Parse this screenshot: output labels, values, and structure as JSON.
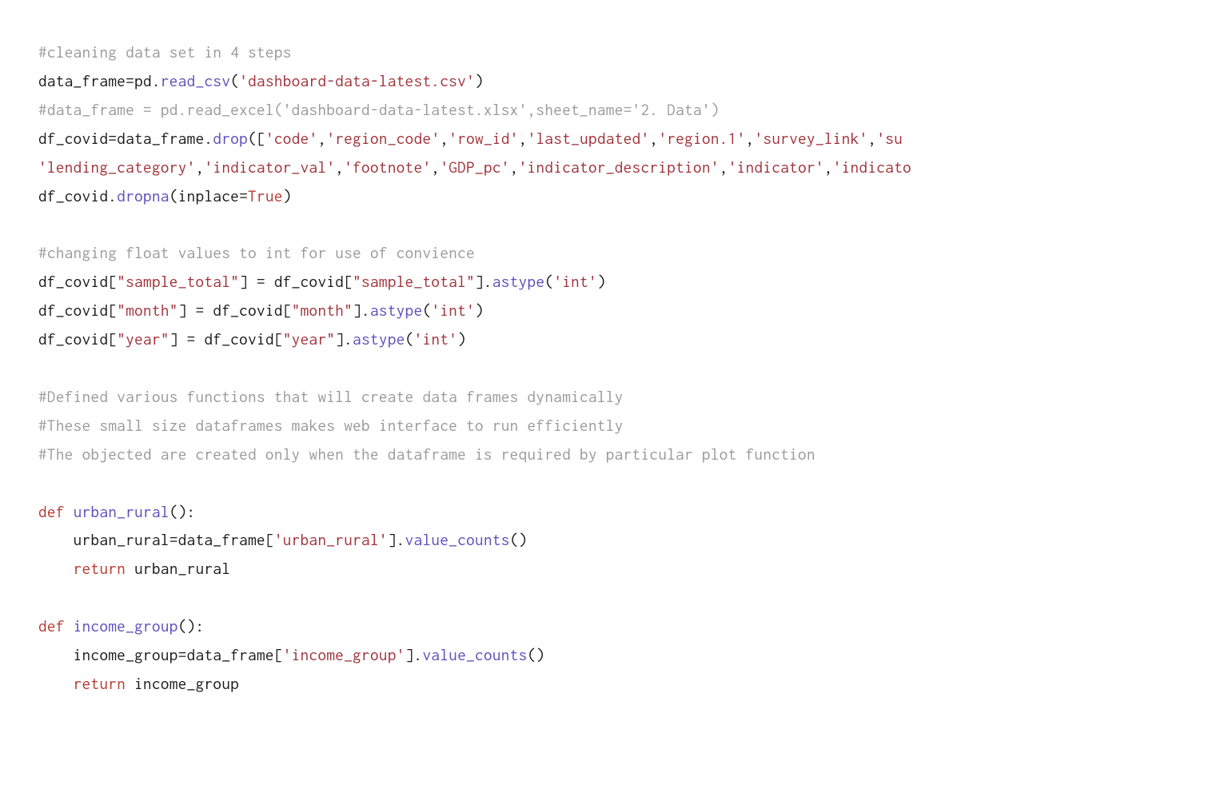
{
  "lines": [
    {
      "tokens": [
        {
          "t": "#cleaning data set in 4 steps",
          "c": "comment"
        }
      ]
    },
    {
      "tokens": [
        {
          "t": "data_frame",
          "c": "plain"
        },
        {
          "t": "=",
          "c": "plain"
        },
        {
          "t": "pd",
          "c": "plain"
        },
        {
          "t": ".",
          "c": "plain"
        },
        {
          "t": "read_csv",
          "c": "func"
        },
        {
          "t": "(",
          "c": "plain"
        },
        {
          "t": "'dashboard-data-latest.csv'",
          "c": "string"
        },
        {
          "t": ")",
          "c": "plain"
        }
      ]
    },
    {
      "tokens": [
        {
          "t": "#data_frame = pd.read_excel('dashboard-data-latest.xlsx',sheet_name='2. Data')",
          "c": "comment"
        }
      ]
    },
    {
      "tokens": [
        {
          "t": "df_covid",
          "c": "plain"
        },
        {
          "t": "=",
          "c": "plain"
        },
        {
          "t": "data_frame",
          "c": "plain"
        },
        {
          "t": ".",
          "c": "plain"
        },
        {
          "t": "drop",
          "c": "func"
        },
        {
          "t": "([",
          "c": "plain"
        },
        {
          "t": "'code'",
          "c": "string"
        },
        {
          "t": ",",
          "c": "plain"
        },
        {
          "t": "'region_code'",
          "c": "string"
        },
        {
          "t": ",",
          "c": "plain"
        },
        {
          "t": "'row_id'",
          "c": "string"
        },
        {
          "t": ",",
          "c": "plain"
        },
        {
          "t": "'last_updated'",
          "c": "string"
        },
        {
          "t": ",",
          "c": "plain"
        },
        {
          "t": "'region.1'",
          "c": "string"
        },
        {
          "t": ",",
          "c": "plain"
        },
        {
          "t": "'survey_link'",
          "c": "string"
        },
        {
          "t": ",",
          "c": "plain"
        },
        {
          "t": "'su",
          "c": "string"
        }
      ]
    },
    {
      "tokens": [
        {
          "t": "'lending_category'",
          "c": "string"
        },
        {
          "t": ",",
          "c": "plain"
        },
        {
          "t": "'indicator_val'",
          "c": "string"
        },
        {
          "t": ",",
          "c": "plain"
        },
        {
          "t": "'footnote'",
          "c": "string"
        },
        {
          "t": ",",
          "c": "plain"
        },
        {
          "t": "'GDP_pc'",
          "c": "string"
        },
        {
          "t": ",",
          "c": "plain"
        },
        {
          "t": "'indicator_description'",
          "c": "string"
        },
        {
          "t": ",",
          "c": "plain"
        },
        {
          "t": "'indicator'",
          "c": "string"
        },
        {
          "t": ",",
          "c": "plain"
        },
        {
          "t": "'indicato",
          "c": "string"
        }
      ]
    },
    {
      "tokens": [
        {
          "t": "df_covid",
          "c": "plain"
        },
        {
          "t": ".",
          "c": "plain"
        },
        {
          "t": "dropna",
          "c": "func"
        },
        {
          "t": "(inplace",
          "c": "plain"
        },
        {
          "t": "=",
          "c": "plain"
        },
        {
          "t": "True",
          "c": "bool"
        },
        {
          "t": ")",
          "c": "plain"
        }
      ]
    },
    {
      "tokens": []
    },
    {
      "tokens": [
        {
          "t": "#changing float values to int for use of convience",
          "c": "comment"
        }
      ]
    },
    {
      "tokens": [
        {
          "t": "df_covid[",
          "c": "plain"
        },
        {
          "t": "\"sample_total\"",
          "c": "string"
        },
        {
          "t": "] ",
          "c": "plain"
        },
        {
          "t": "=",
          "c": "plain"
        },
        {
          "t": " df_covid[",
          "c": "plain"
        },
        {
          "t": "\"sample_total\"",
          "c": "string"
        },
        {
          "t": "]",
          "c": "plain"
        },
        {
          "t": ".",
          "c": "plain"
        },
        {
          "t": "astype",
          "c": "func"
        },
        {
          "t": "(",
          "c": "plain"
        },
        {
          "t": "'int'",
          "c": "string"
        },
        {
          "t": ")",
          "c": "plain"
        }
      ]
    },
    {
      "tokens": [
        {
          "t": "df_covid[",
          "c": "plain"
        },
        {
          "t": "\"month\"",
          "c": "string"
        },
        {
          "t": "] ",
          "c": "plain"
        },
        {
          "t": "=",
          "c": "plain"
        },
        {
          "t": " df_covid[",
          "c": "plain"
        },
        {
          "t": "\"month\"",
          "c": "string"
        },
        {
          "t": "]",
          "c": "plain"
        },
        {
          "t": ".",
          "c": "plain"
        },
        {
          "t": "astype",
          "c": "func"
        },
        {
          "t": "(",
          "c": "plain"
        },
        {
          "t": "'int'",
          "c": "string"
        },
        {
          "t": ")",
          "c": "plain"
        }
      ]
    },
    {
      "tokens": [
        {
          "t": "df_covid[",
          "c": "plain"
        },
        {
          "t": "\"year\"",
          "c": "string"
        },
        {
          "t": "] ",
          "c": "plain"
        },
        {
          "t": "=",
          "c": "plain"
        },
        {
          "t": " df_covid[",
          "c": "plain"
        },
        {
          "t": "\"year\"",
          "c": "string"
        },
        {
          "t": "]",
          "c": "plain"
        },
        {
          "t": ".",
          "c": "plain"
        },
        {
          "t": "astype",
          "c": "func"
        },
        {
          "t": "(",
          "c": "plain"
        },
        {
          "t": "'int'",
          "c": "string"
        },
        {
          "t": ")",
          "c": "plain"
        }
      ]
    },
    {
      "tokens": []
    },
    {
      "tokens": [
        {
          "t": "#Defined various functions that will create data frames dynamically",
          "c": "comment"
        }
      ]
    },
    {
      "tokens": [
        {
          "t": "#These small size dataframes makes web interface to run efficiently",
          "c": "comment"
        }
      ]
    },
    {
      "tokens": [
        {
          "t": "#The objected are created only when the dataframe is required by particular plot function",
          "c": "comment"
        }
      ]
    },
    {
      "tokens": []
    },
    {
      "tokens": [
        {
          "t": "def",
          "c": "keyword"
        },
        {
          "t": " ",
          "c": "plain"
        },
        {
          "t": "urban_rural",
          "c": "func"
        },
        {
          "t": "():",
          "c": "plain"
        }
      ]
    },
    {
      "tokens": [
        {
          "t": "    urban_rural",
          "c": "plain"
        },
        {
          "t": "=",
          "c": "plain"
        },
        {
          "t": "data_frame[",
          "c": "plain"
        },
        {
          "t": "'urban_rural'",
          "c": "string"
        },
        {
          "t": "]",
          "c": "plain"
        },
        {
          "t": ".",
          "c": "plain"
        },
        {
          "t": "value_counts",
          "c": "func"
        },
        {
          "t": "()",
          "c": "plain"
        }
      ]
    },
    {
      "tokens": [
        {
          "t": "    ",
          "c": "plain"
        },
        {
          "t": "return",
          "c": "keyword"
        },
        {
          "t": " urban_rural",
          "c": "plain"
        }
      ]
    },
    {
      "tokens": []
    },
    {
      "tokens": [
        {
          "t": "def",
          "c": "keyword"
        },
        {
          "t": " ",
          "c": "plain"
        },
        {
          "t": "income_group",
          "c": "func"
        },
        {
          "t": "():",
          "c": "plain"
        }
      ]
    },
    {
      "tokens": [
        {
          "t": "    income_group",
          "c": "plain"
        },
        {
          "t": "=",
          "c": "plain"
        },
        {
          "t": "data_frame[",
          "c": "plain"
        },
        {
          "t": "'income_group'",
          "c": "string"
        },
        {
          "t": "]",
          "c": "plain"
        },
        {
          "t": ".",
          "c": "plain"
        },
        {
          "t": "value_counts",
          "c": "func"
        },
        {
          "t": "()",
          "c": "plain"
        }
      ]
    },
    {
      "tokens": [
        {
          "t": "    ",
          "c": "plain"
        },
        {
          "t": "return",
          "c": "keyword"
        },
        {
          "t": " income_group",
          "c": "plain"
        }
      ]
    }
  ]
}
